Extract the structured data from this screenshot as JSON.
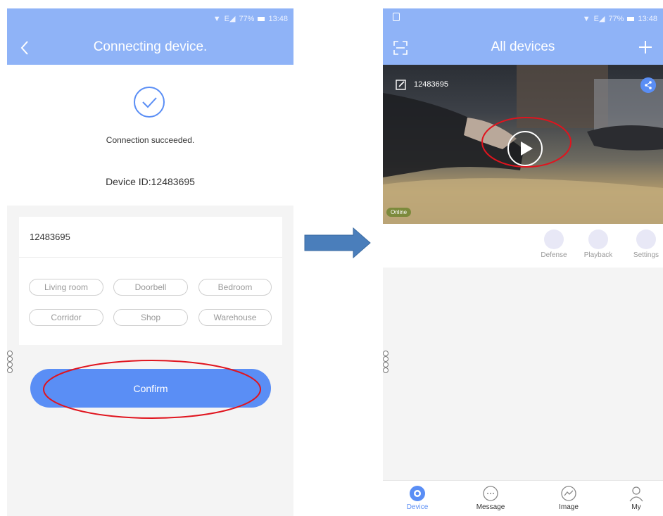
{
  "left": {
    "status": {
      "time": "13:48",
      "battery": "77%"
    },
    "title": "Connecting device.",
    "success_text": "Connection succeeded.",
    "device_id_text": "Device ID:12483695",
    "name_input": {
      "value": "12483695"
    },
    "chips": [
      "Living room",
      "Doorbell",
      "Bedroom",
      "Corridor",
      "Shop",
      "Warehouse"
    ],
    "confirm_label": "Confirm"
  },
  "right": {
    "status": {
      "time": "13:48",
      "battery": "77%"
    },
    "title": "All devices",
    "camera": {
      "name": "12483695",
      "status": "Online"
    },
    "actions": [
      "Defense",
      "Playback",
      "Settings"
    ],
    "nav": [
      "Device",
      "Message",
      "Image",
      "My"
    ],
    "nav_active": "Device"
  },
  "colors": {
    "appbar": "#8fb3f7",
    "primary": "#5a8ef5",
    "annotation": "#e0141e",
    "arrow": "#4a7ebb"
  },
  "icons": [
    "back-icon",
    "check-circle-icon",
    "scan-icon",
    "plus-icon",
    "edit-icon",
    "share-icon",
    "play-icon",
    "defense-icon",
    "playback-icon",
    "settings-icon",
    "device-nav-icon",
    "message-nav-icon",
    "image-nav-icon",
    "my-nav-icon",
    "right-arrow-icon"
  ]
}
